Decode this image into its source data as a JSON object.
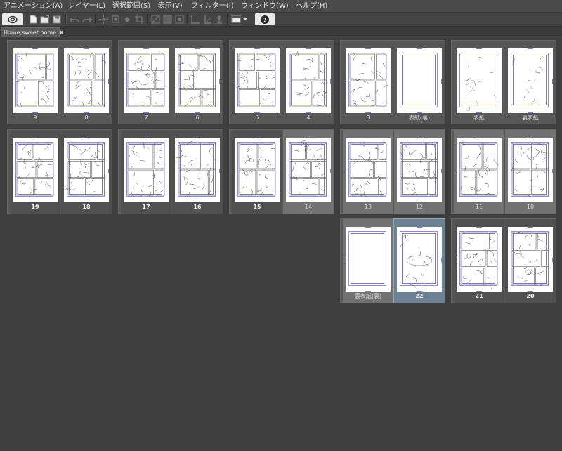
{
  "menu": [
    "アニメーション(A)",
    "レイヤー(L)",
    "選択範囲(S)",
    "表示(V)",
    "フィルター(I)",
    "ウィンドウ(W)",
    "ヘルプ(H)"
  ],
  "toolbar": {
    "icons": [
      "clip-studio-icon",
      "new-file-icon",
      "open-file-icon",
      "save-icon",
      "undo-icon",
      "redo-icon",
      "transform-1-icon",
      "transform-2-icon",
      "fill-icon",
      "crop-icon",
      "clear-icon",
      "fill-layer-icon",
      "border-icon",
      "ruler-icon",
      "snap-icon",
      "grid-icon",
      "window-menu-icon",
      "help-icon"
    ]
  },
  "tab": {
    "title": "Home,sweet home",
    "close": "✖"
  },
  "spreads": [
    {
      "pages": [
        {
          "label": "9",
          "kind": "sketch"
        },
        {
          "label": "8",
          "kind": "sketch"
        }
      ]
    },
    {
      "pages": [
        {
          "label": "7",
          "kind": "sketch"
        },
        {
          "label": "6",
          "kind": "sketch"
        }
      ]
    },
    {
      "pages": [
        {
          "label": "5",
          "kind": "sketch"
        },
        {
          "label": "4",
          "kind": "sketch"
        }
      ]
    },
    {
      "pages": [
        {
          "label": "3",
          "kind": "sketch"
        },
        {
          "label": "表紙(裏)",
          "kind": "blank"
        }
      ]
    },
    {
      "pages": [
        {
          "label": "表紙",
          "kind": "cover"
        },
        {
          "label": "裏表紙",
          "kind": "cover"
        }
      ]
    },
    {
      "pages": [
        {
          "label": "19",
          "kind": "sketch",
          "bold": true
        },
        {
          "label": "18",
          "kind": "sketch",
          "bold": true
        }
      ]
    },
    {
      "pages": [
        {
          "label": "17",
          "kind": "sketch",
          "bold": true
        },
        {
          "label": "16",
          "kind": "sketch",
          "bold": true
        }
      ]
    },
    {
      "pages": [
        {
          "label": "15",
          "kind": "sketch",
          "bold": true
        },
        {
          "label": "14",
          "kind": "sketch"
        }
      ]
    },
    {
      "pages": [
        {
          "label": "13",
          "kind": "sketch"
        },
        {
          "label": "12",
          "kind": "sketch"
        }
      ]
    },
    {
      "pages": [
        {
          "label": "11",
          "kind": "sketch"
        },
        {
          "label": "10",
          "kind": "sketch"
        }
      ]
    },
    {
      "pages": [
        {
          "label": "裏表紙(裏)",
          "kind": "blank"
        },
        {
          "label": "22",
          "kind": "title",
          "bold": true,
          "selected": true
        }
      ]
    },
    {
      "pages": [
        {
          "label": "21",
          "kind": "sketch",
          "bold": true
        },
        {
          "label": "20",
          "kind": "sketch",
          "bold": true
        }
      ]
    }
  ]
}
